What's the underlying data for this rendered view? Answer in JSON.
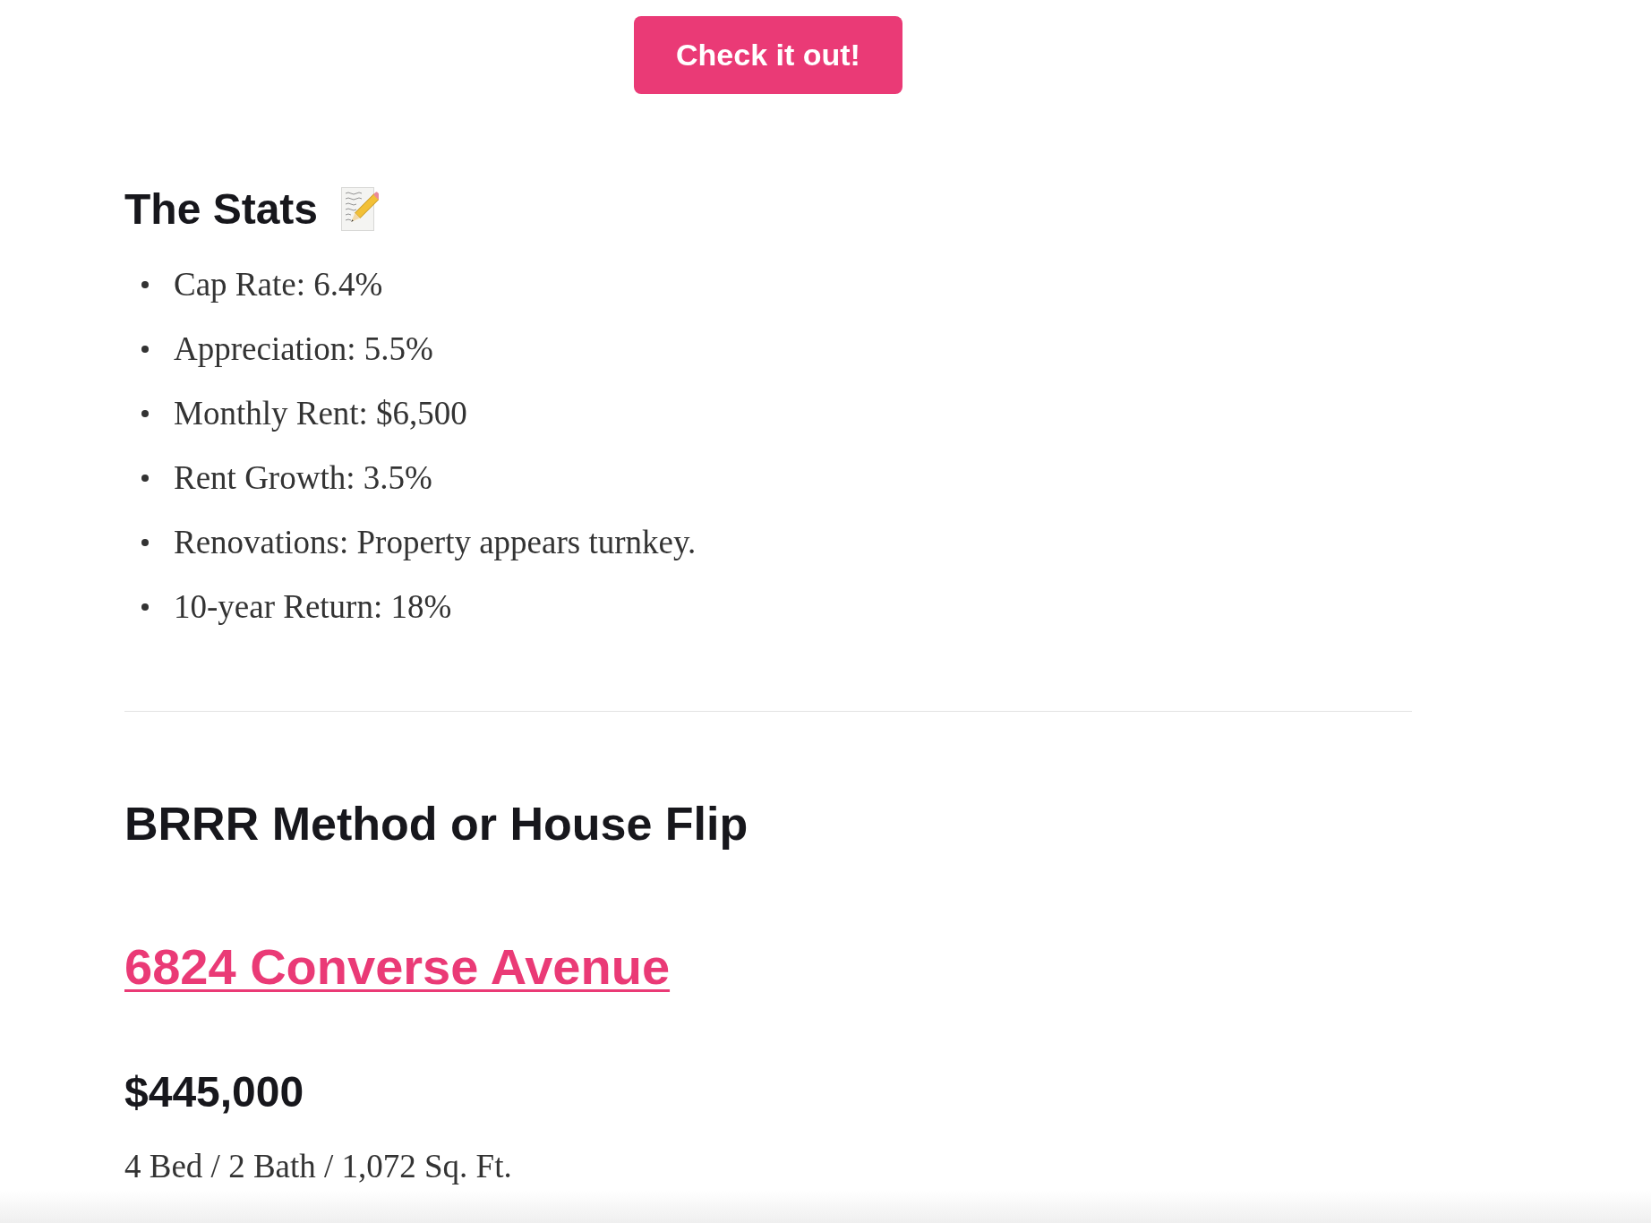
{
  "cta_button": {
    "label": "Check it out!"
  },
  "stats_section": {
    "heading": "The Stats",
    "items": [
      "Cap Rate: 6.4%",
      "Appreciation: 5.5%",
      "Monthly Rent: $6,500",
      "Rent Growth: 3.5%",
      "Renovations: Property appears turnkey.",
      "10-year Return: 18%"
    ]
  },
  "deal": {
    "heading": "BRRR Method or House Flip",
    "address_link": "6824 Converse Avenue",
    "price": "$445,000",
    "specs": "4 Bed / 2 Bath / 1,072 Sq. Ft."
  }
}
